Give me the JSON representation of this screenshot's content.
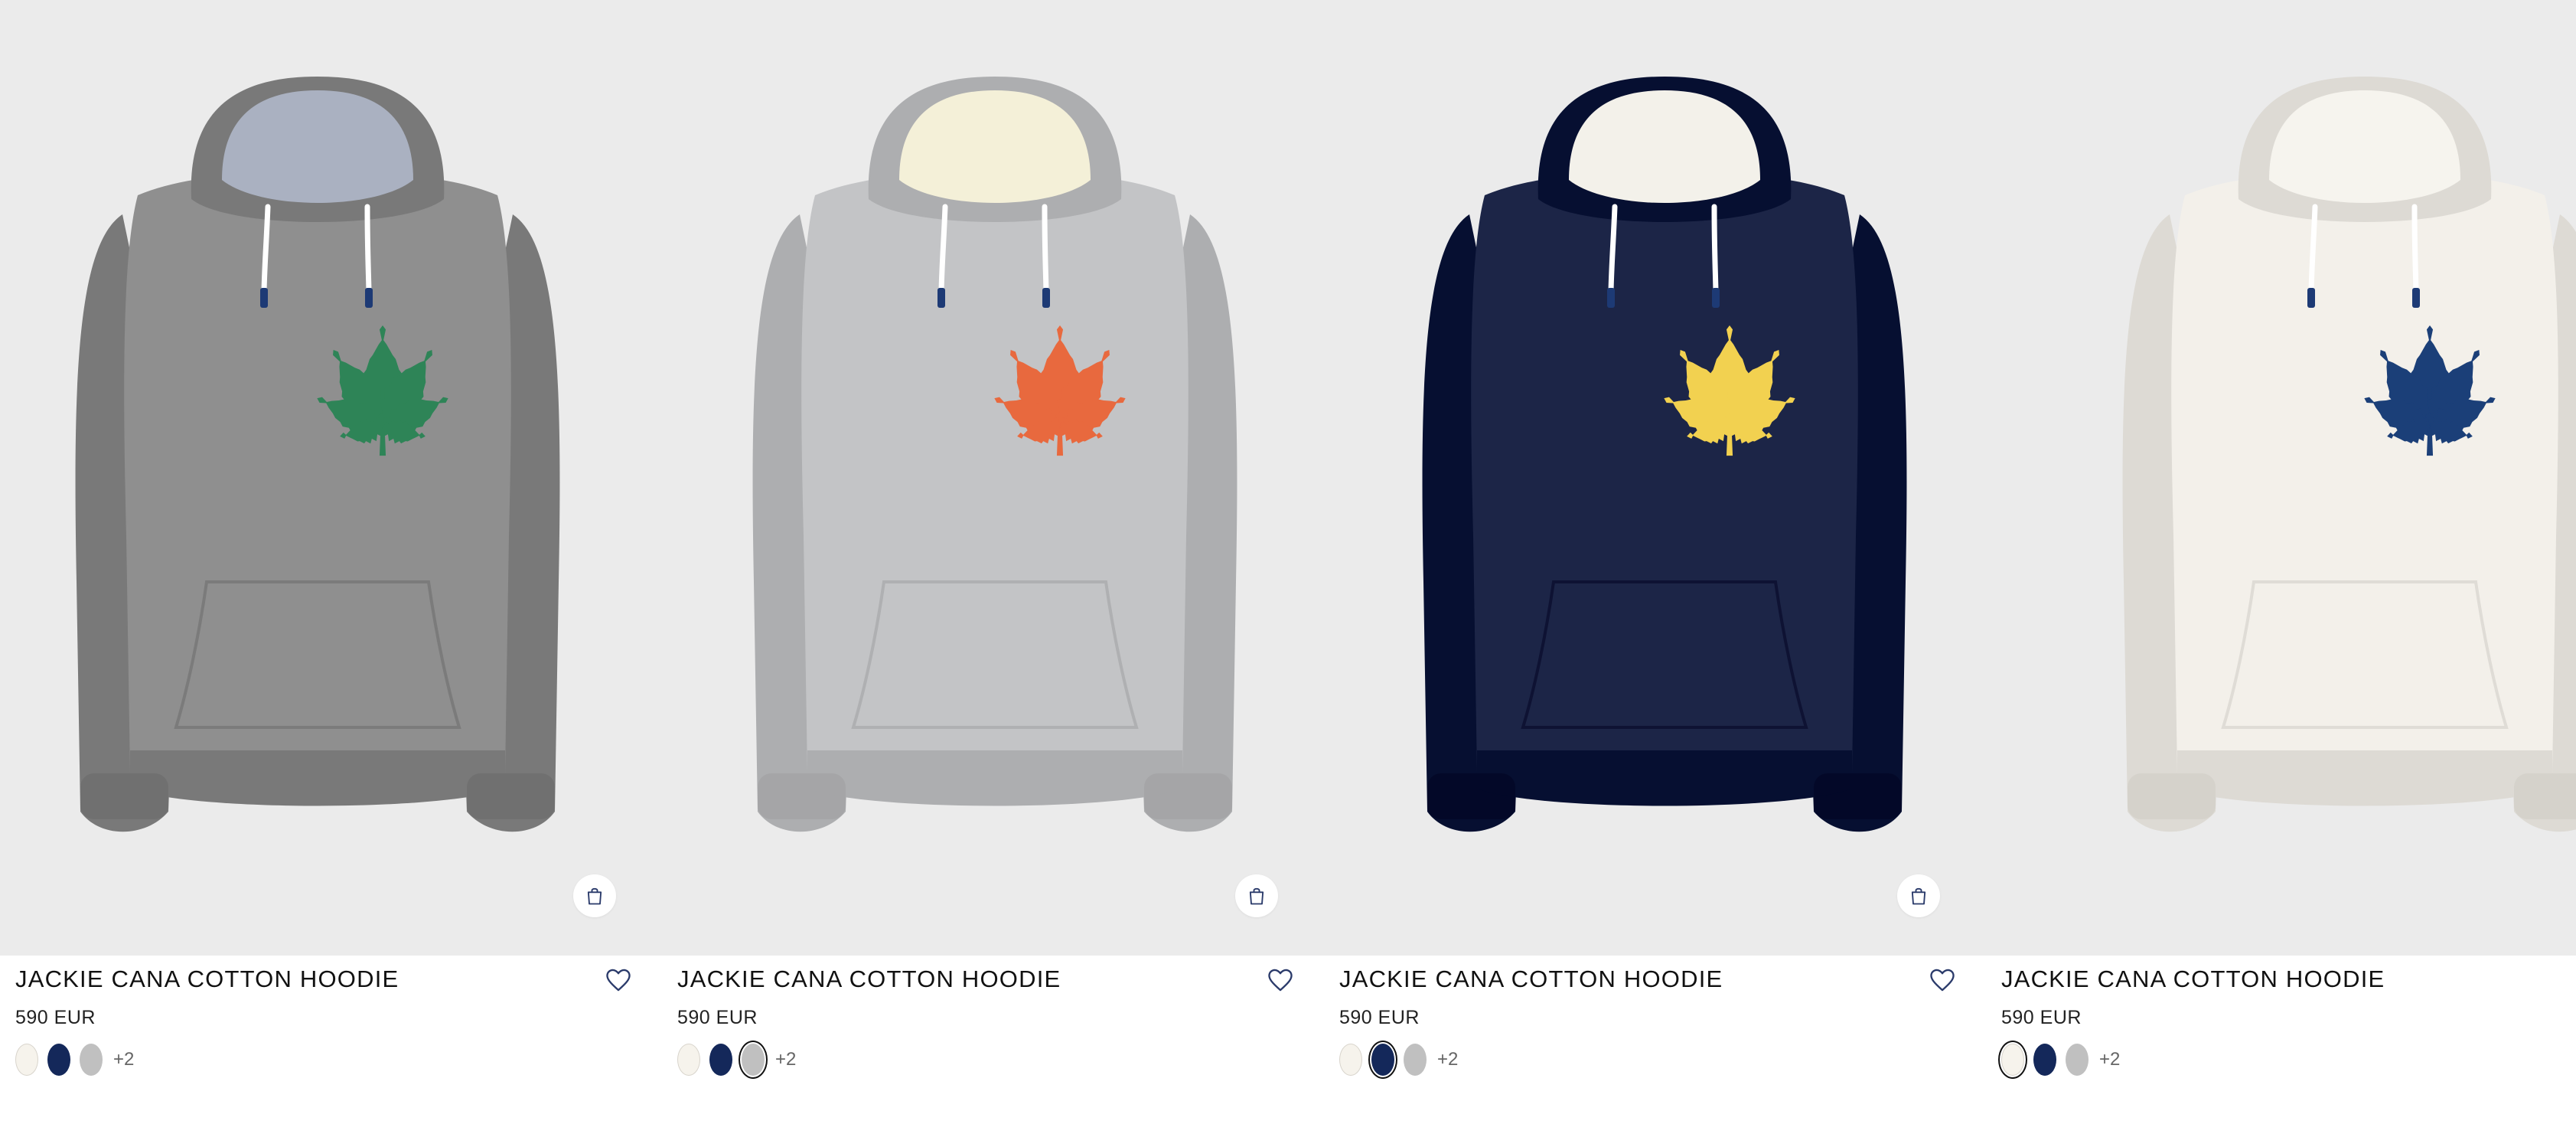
{
  "products": [
    {
      "title": "JACKIE CANA COTTON HOODIE",
      "price": "590 EUR",
      "more_colors": "+2",
      "hoodie_color": "#8f8f8f",
      "hood_lining_color": "#aab1c1",
      "leaf_color": "#2e8457",
      "has_bag_button": true,
      "swatches": [
        {
          "color": "#f6f3ec",
          "selected": false
        },
        {
          "color": "#14285a",
          "selected": false
        },
        {
          "color": "#c0c0c0",
          "selected": false
        }
      ]
    },
    {
      "title": "JACKIE CANA COTTON HOODIE",
      "price": "590 EUR",
      "more_colors": "+2",
      "hoodie_color": "#c3c4c6",
      "hood_lining_color": "#f4f0d8",
      "leaf_color": "#e8693e",
      "has_bag_button": true,
      "swatches": [
        {
          "color": "#f6f3ec",
          "selected": false
        },
        {
          "color": "#14285a",
          "selected": false
        },
        {
          "color": "#c0c0c0",
          "selected": true
        }
      ]
    },
    {
      "title": "JACKIE CANA COTTON HOODIE",
      "price": "590 EUR",
      "more_colors": "+2",
      "hoodie_color": "#1c2547",
      "hood_lining_color": "#f3f1ea",
      "leaf_color": "#f2d150",
      "has_bag_button": true,
      "swatches": [
        {
          "color": "#f6f3ec",
          "selected": false
        },
        {
          "color": "#14285a",
          "selected": true
        },
        {
          "color": "#c0c0c0",
          "selected": false
        }
      ]
    },
    {
      "title": "JACKIE CANA COTTON HOODIE",
      "price": "590 EUR",
      "more_colors": "+2",
      "hoodie_color": "#f3f0ea",
      "hood_lining_color": "#f6f4ee",
      "leaf_color": "#1b3f78",
      "has_bag_button": false,
      "swatches": [
        {
          "color": "#f6f3ec",
          "selected": true
        },
        {
          "color": "#14285a",
          "selected": false
        },
        {
          "color": "#c0c0c0",
          "selected": false
        }
      ]
    }
  ],
  "icons": {
    "bag": "shopping-bag-icon",
    "favorite": "heart-icon"
  }
}
